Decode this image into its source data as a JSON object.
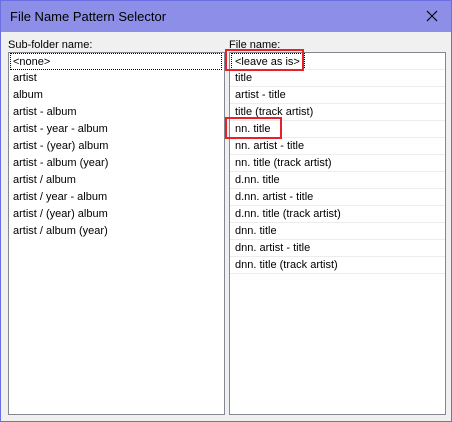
{
  "window": {
    "title": "File Name Pattern Selector"
  },
  "left": {
    "label": "Sub-folder name:",
    "items": [
      "<none>",
      "artist",
      "album",
      "artist - album",
      "artist - year - album",
      "artist - (year) album",
      "artist - album (year)",
      "artist / album",
      "artist / year - album",
      "artist / (year) album",
      "artist / album (year)"
    ],
    "selected_index": 0
  },
  "right": {
    "label": "File name:",
    "items": [
      "<leave as is>",
      "title",
      "artist - title",
      "title (track artist)",
      "nn. title",
      "nn. artist - title",
      "nn. title (track artist)",
      "d.nn. title",
      "d.nn. artist - title",
      "d.nn. title (track artist)",
      "dnn. title",
      "dnn. artist - title",
      "dnn. title (track artist)"
    ],
    "selected_index": 0,
    "highlighted_indices": [
      0,
      4
    ]
  },
  "icons": {
    "close": "close-icon"
  },
  "colors": {
    "titlebar": "#8c8ee8",
    "highlight_box": "#e8202a",
    "list_border": "#828790"
  }
}
